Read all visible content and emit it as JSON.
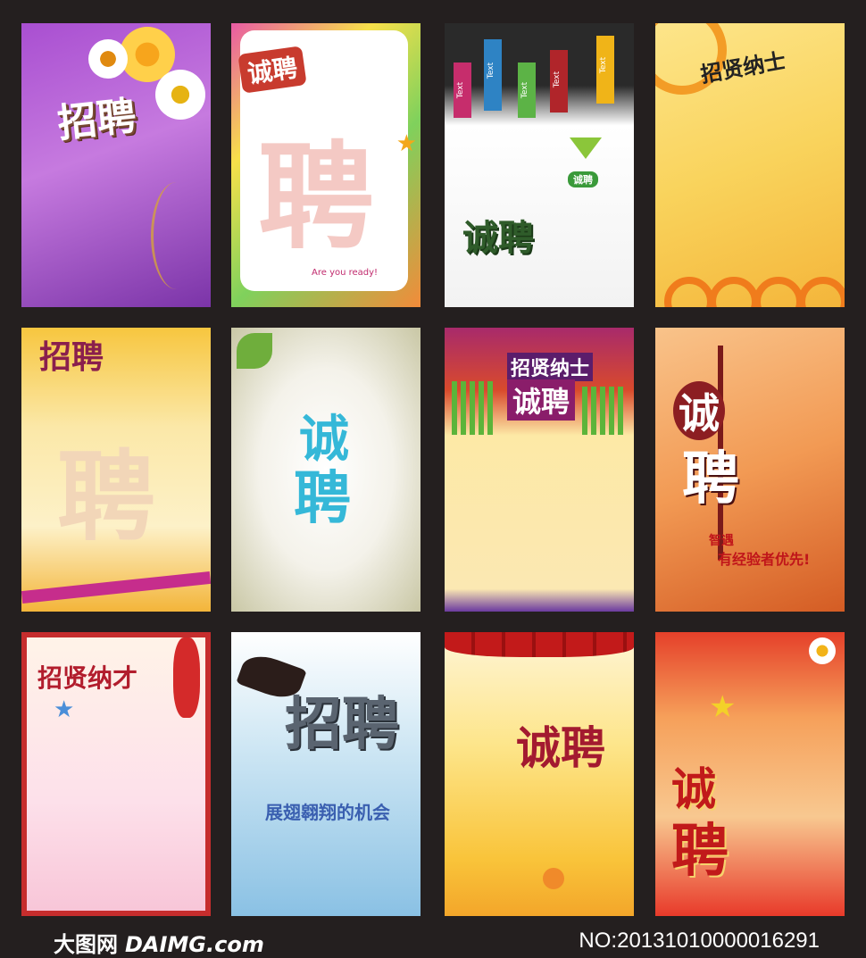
{
  "posters": [
    {
      "headline": "招聘"
    },
    {
      "tag": "诚聘",
      "big": "聘",
      "slogan": "Are you ready!"
    },
    {
      "arrow_labels": [
        "Text",
        "Text",
        "Text",
        "Text",
        "Text"
      ],
      "badge": "诚聘",
      "headline": "诚聘"
    },
    {
      "headline": "招贤纳士"
    },
    {
      "headline": "招聘",
      "watermark": "聘"
    },
    {
      "line1": "诚",
      "line2": "聘"
    },
    {
      "top": "招贤纳士",
      "headline": "诚聘"
    },
    {
      "line1": "诚",
      "line2": "聘",
      "slogan_a": "智遇",
      "slogan_b": "有经验者优先!"
    },
    {
      "headline": "招贤纳才"
    },
    {
      "headline": "招聘",
      "tagline": "展翅翱翔的机会"
    },
    {
      "headline": "诚聘"
    },
    {
      "line1": "诚",
      "line2": "聘"
    }
  ],
  "footer": {
    "site_cn": "大图网",
    "site_en": "DAIMG.com",
    "number": "NO:20131010000016291"
  }
}
